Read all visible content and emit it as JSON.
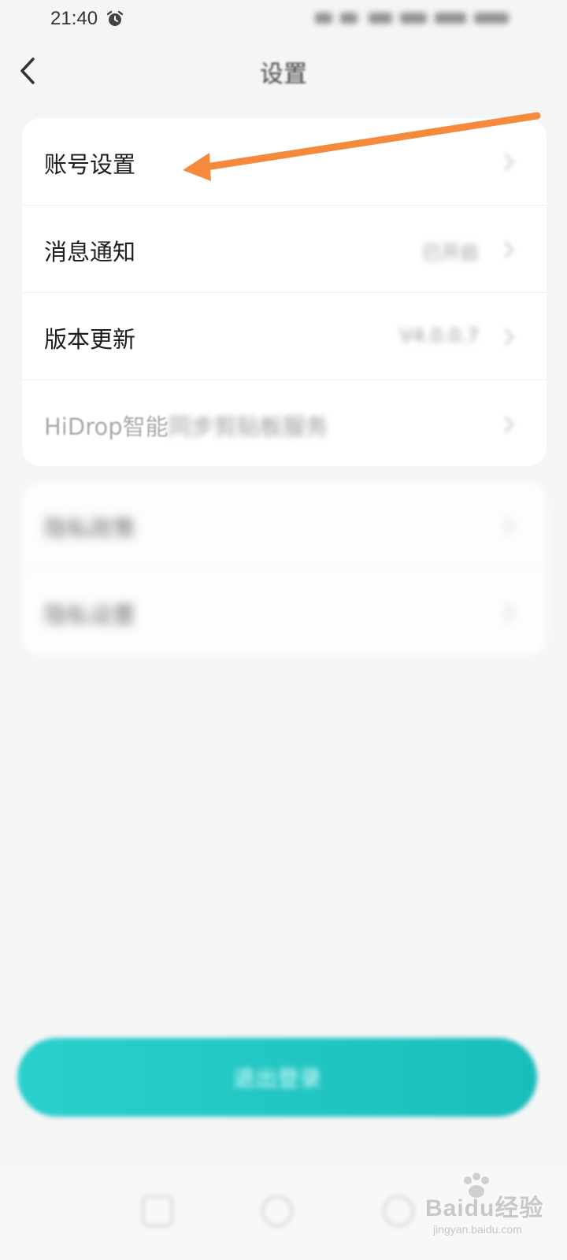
{
  "status_bar": {
    "time": "21:40",
    "alarm_icon": "alarm-clock-icon"
  },
  "header": {
    "title": "设置",
    "back_icon": "chevron-left-icon"
  },
  "settings_group_1": {
    "items": [
      {
        "label": "账号设置",
        "value": ""
      },
      {
        "label": "消息通知",
        "value": "已开启"
      },
      {
        "label": "版本更新",
        "value": "V4.0.0.7"
      },
      {
        "label": "HiDrop智能",
        "label_tail": "同步剪贴板服务",
        "value": ""
      }
    ]
  },
  "settings_group_2": {
    "items": [
      {
        "label": "隐私政策"
      },
      {
        "label": "隐私设置"
      }
    ]
  },
  "logout": {
    "label": "退出登录",
    "color": "#1cc4c1"
  },
  "annotation": {
    "arrow_color": "#f58a3c"
  },
  "watermark": {
    "brand": "Baidu经验",
    "sub": "jingyan.baidu.com"
  }
}
